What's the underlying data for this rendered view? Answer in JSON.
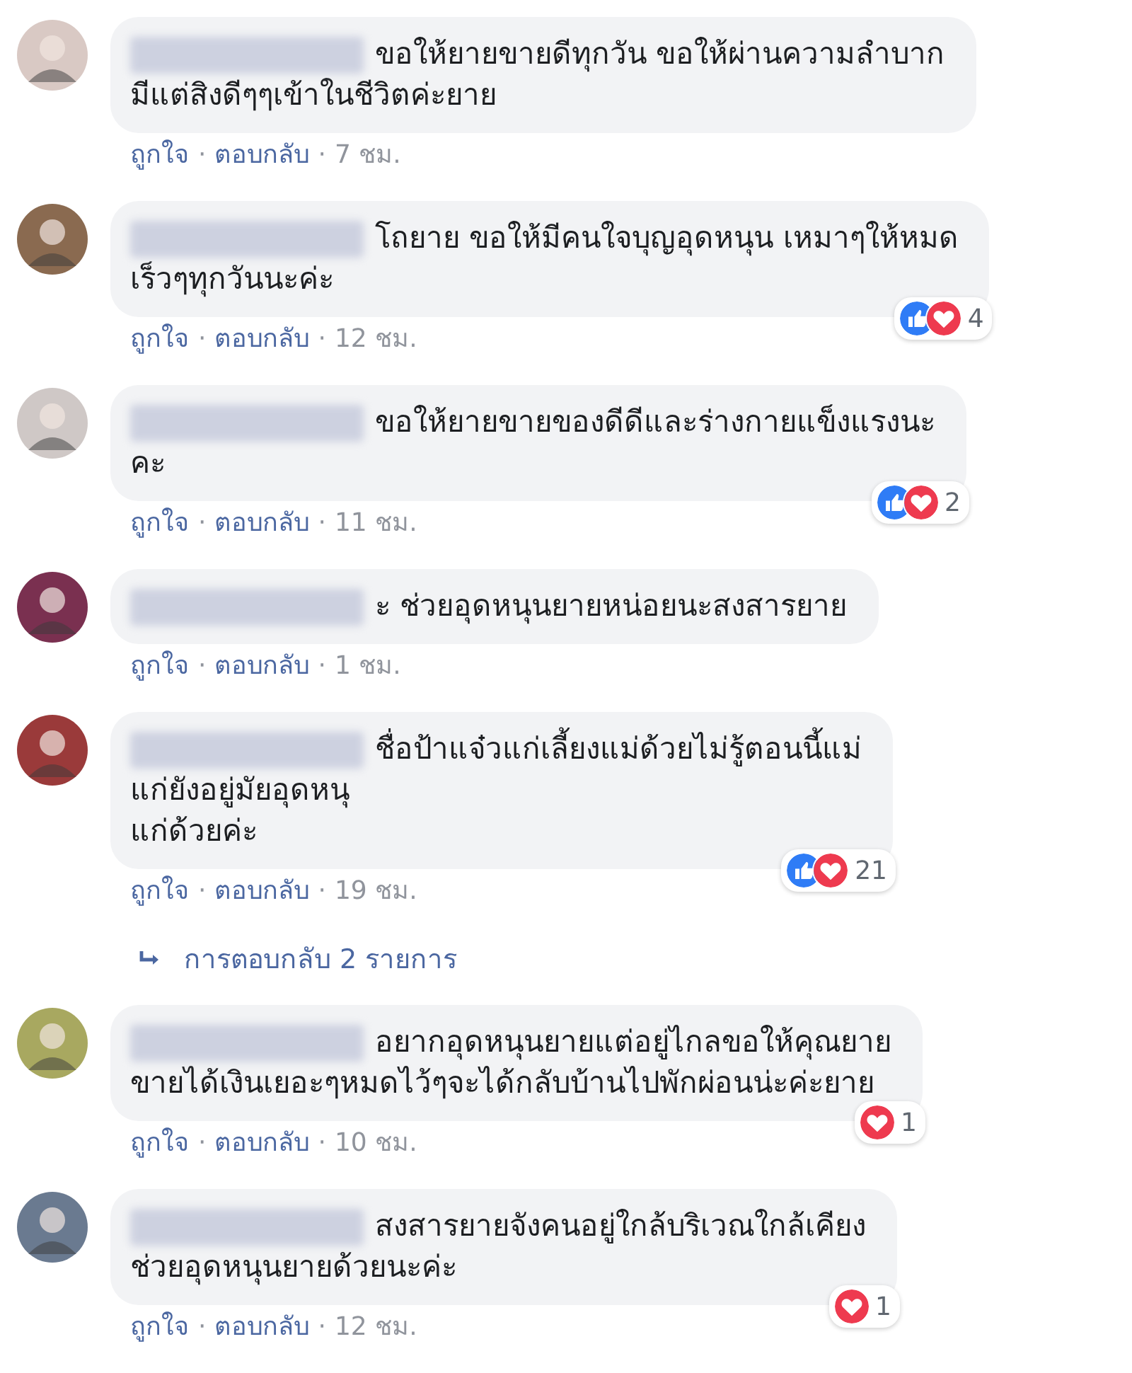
{
  "comments": [
    {
      "lines": [
        "ขอให้ยายขายดีทุกวัน ขอให้ผ่านความลำบาก",
        "มีแต่สิงดีๆๆเข้าในชีวิตค่ะยาย"
      ],
      "actions": [
        {
          "kind": "link",
          "text": "ถูกใจ"
        },
        {
          "kind": "sep",
          "text": "·"
        },
        {
          "kind": "link",
          "text": "ตอบกลับ"
        },
        {
          "kind": "sep",
          "text": "·"
        },
        {
          "kind": "time",
          "text": "7 ชม."
        }
      ]
    },
    {
      "lines": [
        "โถยาย ขอให้มีคนใจบุญอุดหนุน เหมาๆให้หมด",
        "เร็วๆทุกวันนะค่ะ"
      ],
      "actions": [
        {
          "kind": "link",
          "text": "ถูกใจ"
        },
        {
          "kind": "sep",
          "text": "·"
        },
        {
          "kind": "link",
          "text": "ตอบกลับ"
        },
        {
          "kind": "sep",
          "text": "·"
        },
        {
          "kind": "time",
          "text": "12 ชม."
        }
      ],
      "reactions": {
        "like": true,
        "love": true,
        "count": "4"
      }
    },
    {
      "lines": [
        "ขอให้ยายขายของดีดีและร่างกายแข็งแรงนะ",
        "คะ"
      ],
      "actions": [
        {
          "kind": "link",
          "text": "ถูกใจ"
        },
        {
          "kind": "sep",
          "text": "·"
        },
        {
          "kind": "link",
          "text": "ตอบกลับ"
        },
        {
          "kind": "sep",
          "text": "·"
        },
        {
          "kind": "time",
          "text": "11 ชม."
        }
      ],
      "reactions": {
        "like": true,
        "love": true,
        "count": "2"
      }
    },
    {
      "lines": [
        "ะ ช่วยอุดหนุนยายหน่อยนะสงสารยาย"
      ],
      "actions": [
        {
          "kind": "link",
          "text": "ถูกใจ"
        },
        {
          "kind": "sep",
          "text": "·"
        },
        {
          "kind": "link",
          "text": "ตอบกลับ"
        },
        {
          "kind": "sep",
          "text": "·"
        },
        {
          "kind": "time",
          "text": "1 ชม."
        }
      ]
    },
    {
      "lines": [
        "ชื่อป้าแจ๋วแก่เลี้ยงแม่ด้วยไม่รู้ตอนนี้แม่",
        "แก่ยังอยู่มัยอุดหนุ",
        "แก่ด้วยค่ะ"
      ],
      "actions": [
        {
          "kind": "link",
          "text": "ถูกใจ"
        },
        {
          "kind": "sep",
          "text": "·"
        },
        {
          "kind": "link",
          "text": "ตอบกลับ"
        },
        {
          "kind": "sep",
          "text": "·"
        },
        {
          "kind": "time",
          "text": "19 ชม."
        }
      ],
      "reactions": {
        "like": true,
        "love": true,
        "count": "21"
      },
      "replies": "การตอบกลับ 2 รายการ"
    },
    {
      "lines": [
        "อยากอุดหนุนยายแต่อยู่ไกลขอให้คุณยาย",
        "ขายได้เงินเยอะๆหมดไว้ๆจะได้กลับบ้านไปพักผ่อนน่ะค่ะยาย"
      ],
      "actions": [
        {
          "kind": "link",
          "text": "ถูกใจ"
        },
        {
          "kind": "sep",
          "text": "·"
        },
        {
          "kind": "link",
          "text": "ตอบกลับ"
        },
        {
          "kind": "sep",
          "text": "·"
        },
        {
          "kind": "time",
          "text": "10 ชม."
        }
      ],
      "reactions": {
        "like": false,
        "love": true,
        "count": "1"
      }
    },
    {
      "lines": [
        "สงสารยายจังคนอยู่ใกล้บริเวณใกล้เคียง",
        "ช่วยอุดหนุนยายด้วยนะค่ะ"
      ],
      "actions": [
        {
          "kind": "link",
          "text": "ถูกใจ"
        },
        {
          "kind": "sep",
          "text": "·"
        },
        {
          "kind": "link",
          "text": "ตอบกลับ"
        },
        {
          "kind": "sep",
          "text": "·"
        },
        {
          "kind": "time",
          "text": "12 ชม."
        }
      ],
      "reactions": {
        "like": false,
        "love": true,
        "count": "1"
      }
    }
  ]
}
